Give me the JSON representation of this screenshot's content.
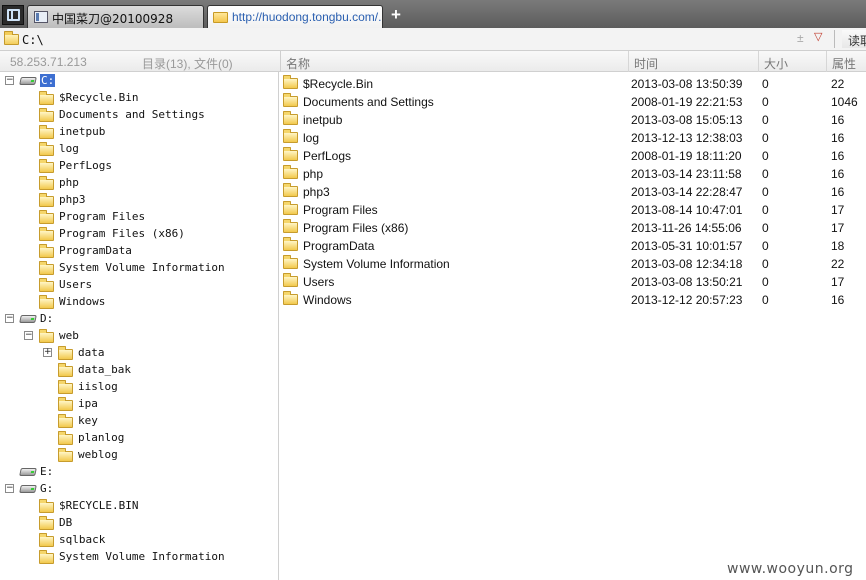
{
  "tabs": [
    {
      "label": "中国菜刀@20100928",
      "active": false
    },
    {
      "label": "http://huodong.tongbu.com/...",
      "active": true
    }
  ],
  "new_tab_label": "+",
  "address": {
    "value": "C:\\",
    "plus_minus": "±",
    "read_label": "读取"
  },
  "header": {
    "ip": "58.253.71.213",
    "status": "目录(13), 文件(0)",
    "columns": {
      "name": "名称",
      "time": "时间",
      "size": "大小",
      "attr": "属性"
    }
  },
  "tree": [
    {
      "label": "C:",
      "type": "drive",
      "expanded": true,
      "selected": true,
      "children": [
        "$Recycle.Bin",
        "Documents and Settings",
        "inetpub",
        "log",
        "PerfLogs",
        "php",
        "php3",
        "Program Files",
        "Program Files (x86)",
        "ProgramData",
        "System Volume Information",
        "Users",
        "Windows"
      ]
    },
    {
      "label": "D:",
      "type": "drive",
      "expanded": true,
      "children": [
        {
          "label": "web",
          "expanded": true,
          "children": [
            {
              "label": "data",
              "collapsed": true
            },
            "data_bak",
            "iislog",
            "ipa",
            "key",
            "planlog",
            "weblog"
          ]
        }
      ]
    },
    {
      "label": "E:",
      "type": "drive",
      "expanded": false,
      "children": []
    },
    {
      "label": "G:",
      "type": "drive",
      "expanded": true,
      "children": [
        "$RECYCLE.BIN",
        "DB",
        "sqlback",
        "System Volume Information"
      ]
    }
  ],
  "files": [
    {
      "name": "$Recycle.Bin",
      "time": "2013-03-08 13:50:39",
      "size": "0",
      "attr": "22"
    },
    {
      "name": "Documents and Settings",
      "time": "2008-01-19 22:21:53",
      "size": "0",
      "attr": "1046"
    },
    {
      "name": "inetpub",
      "time": "2013-03-08 15:05:13",
      "size": "0",
      "attr": "16"
    },
    {
      "name": "log",
      "time": "2013-12-13 12:38:03",
      "size": "0",
      "attr": "16"
    },
    {
      "name": "PerfLogs",
      "time": "2008-01-19 18:11:20",
      "size": "0",
      "attr": "16"
    },
    {
      "name": "php",
      "time": "2013-03-14 23:11:58",
      "size": "0",
      "attr": "16"
    },
    {
      "name": "php3",
      "time": "2013-03-14 22:28:47",
      "size": "0",
      "attr": "16"
    },
    {
      "name": "Program Files",
      "time": "2013-08-14 10:47:01",
      "size": "0",
      "attr": "17"
    },
    {
      "name": "Program Files (x86)",
      "time": "2013-11-26 14:55:06",
      "size": "0",
      "attr": "17"
    },
    {
      "name": "ProgramData",
      "time": "2013-05-31 10:01:57",
      "size": "0",
      "attr": "18"
    },
    {
      "name": "System Volume Information",
      "time": "2013-03-08 12:34:18",
      "size": "0",
      "attr": "22"
    },
    {
      "name": "Users",
      "time": "2013-03-08 13:50:21",
      "size": "0",
      "attr": "17"
    },
    {
      "name": "Windows",
      "time": "2013-12-12 20:57:23",
      "size": "0",
      "attr": "16"
    }
  ],
  "watermark": "www.wooyun.org",
  "icons": {
    "tab_menu": "window-icon",
    "folder": "folder-icon",
    "drive": "drive-icon",
    "expand": "expand-toggle-icon"
  },
  "colors": {
    "selection": "#3d6fd1",
    "tab_link": "#2a5fb0",
    "folder": "#f2c94c"
  }
}
